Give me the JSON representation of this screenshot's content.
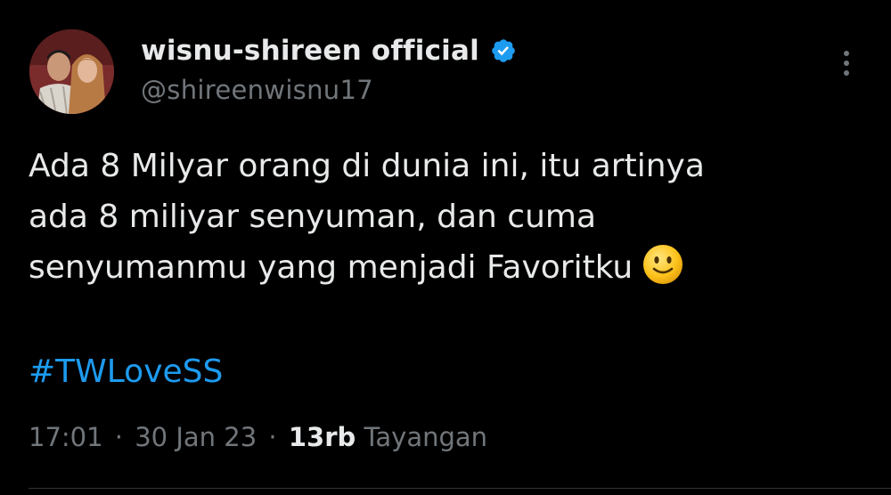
{
  "tweet": {
    "author": {
      "display_name": "wisnu-shireen official",
      "handle": "@shireenwisnu17",
      "verified": true
    },
    "lines": [
      "Ada 8 Milyar orang di dunia ini, itu artinya",
      "ada 8 miliyar senyuman, dan cuma",
      "senyumanmu yang menjadi Favoritku"
    ],
    "emoji": "slightly-smiling-face",
    "hashtag": "#TWLoveSS",
    "meta": {
      "time": "17:01",
      "separator": "·",
      "date": "30 Jan 23",
      "views_count": "13rb",
      "views_label": "Tayangan"
    }
  },
  "colors": {
    "background": "#000000",
    "text": "#e7e9ea",
    "secondary": "#71767b",
    "link": "#1d9bf0",
    "verified": "#1d9bf0"
  }
}
